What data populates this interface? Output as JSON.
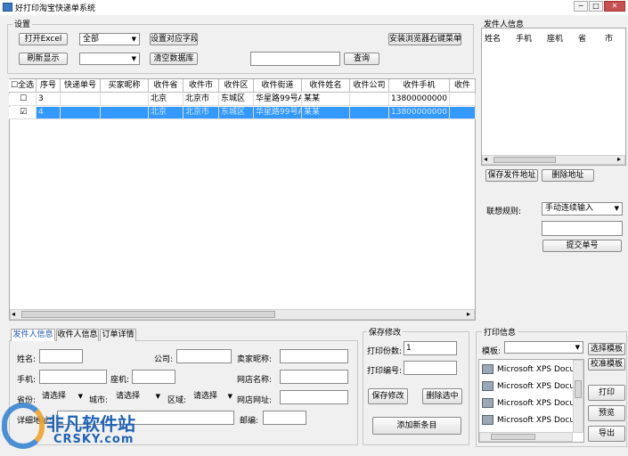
{
  "window": {
    "title": "好打印淘宝快递单系统"
  },
  "settings": {
    "label": "设置",
    "open_excel": "打开Excel",
    "status_select": "全部",
    "set_field": "设置对应字段",
    "install_context": "安装浏览器右键菜单",
    "refresh": "刷新显示",
    "second_select": "",
    "clear_db": "清空数据库",
    "search_value": "",
    "search_button": "查询"
  },
  "table": {
    "columns": [
      "全选",
      "序号",
      "快递单号",
      "买家昵称",
      "收件省",
      "收件市",
      "收件区",
      "收件街道",
      "收件姓名",
      "收件公司",
      "收件手机",
      "收件"
    ],
    "rows": [
      {
        "checked": false,
        "cells": [
          "3",
          "",
          "",
          "北京",
          "北京市",
          "东城区",
          "华星路99号A...",
          "某某",
          "",
          "13800000000"
        ]
      },
      {
        "checked": true,
        "cells": [
          "4",
          "",
          "",
          "北京",
          "北京市",
          "东城区",
          "华星路99号A...",
          "某某",
          "",
          "13800000000"
        ]
      }
    ]
  },
  "sender_info": {
    "label": "发件人信息",
    "columns": [
      "姓名",
      "手机",
      "座机",
      "省",
      "市"
    ],
    "save_address": "保存发件地址",
    "delete_address": "删除地址"
  },
  "association": {
    "label": "联想规则:",
    "mode": "手动连续输入",
    "input_value": "",
    "submit": "提交单号"
  },
  "tabs": [
    "发件人信息",
    "收件人信息",
    "订单详情"
  ],
  "sender_form": {
    "name_label": "姓名:",
    "company_label": "公司:",
    "nick_label": "卖家昵称:",
    "mobile_label": "手机:",
    "phone_label": "座机:",
    "shop_label": "网店名称:",
    "province_label": "省份:",
    "province_value": "请选择",
    "city_label": "城市:",
    "city_value": "请选择",
    "district_label": "区域:",
    "district_value": "请选择",
    "url_label": "网店网址:",
    "address_label": "详细地址:",
    "postcode_label": "邮编:"
  },
  "save_panel": {
    "label": "保存修改",
    "copies_label": "打印份数:",
    "copies_value": "1",
    "number_label": "打印编号:",
    "number_value": "",
    "save_button": "保存修改",
    "delete_button": "删除选中",
    "add_button": "添加新条目"
  },
  "print_panel": {
    "label": "打印信息",
    "template_label": "模板:",
    "template_value": "",
    "select_template": "选择模板",
    "calibrate_template": "校准模板",
    "printers": [
      "Microsoft XPS Docu",
      "Microsoft XPS Docu",
      "Microsoft XPS Docu",
      "Microsoft XPS Docu"
    ],
    "print_button": "打印",
    "preview_button": "预览",
    "export_button": "导出"
  },
  "watermark": {
    "text": "非凡软件站",
    "sub": "CRSKY.com"
  }
}
